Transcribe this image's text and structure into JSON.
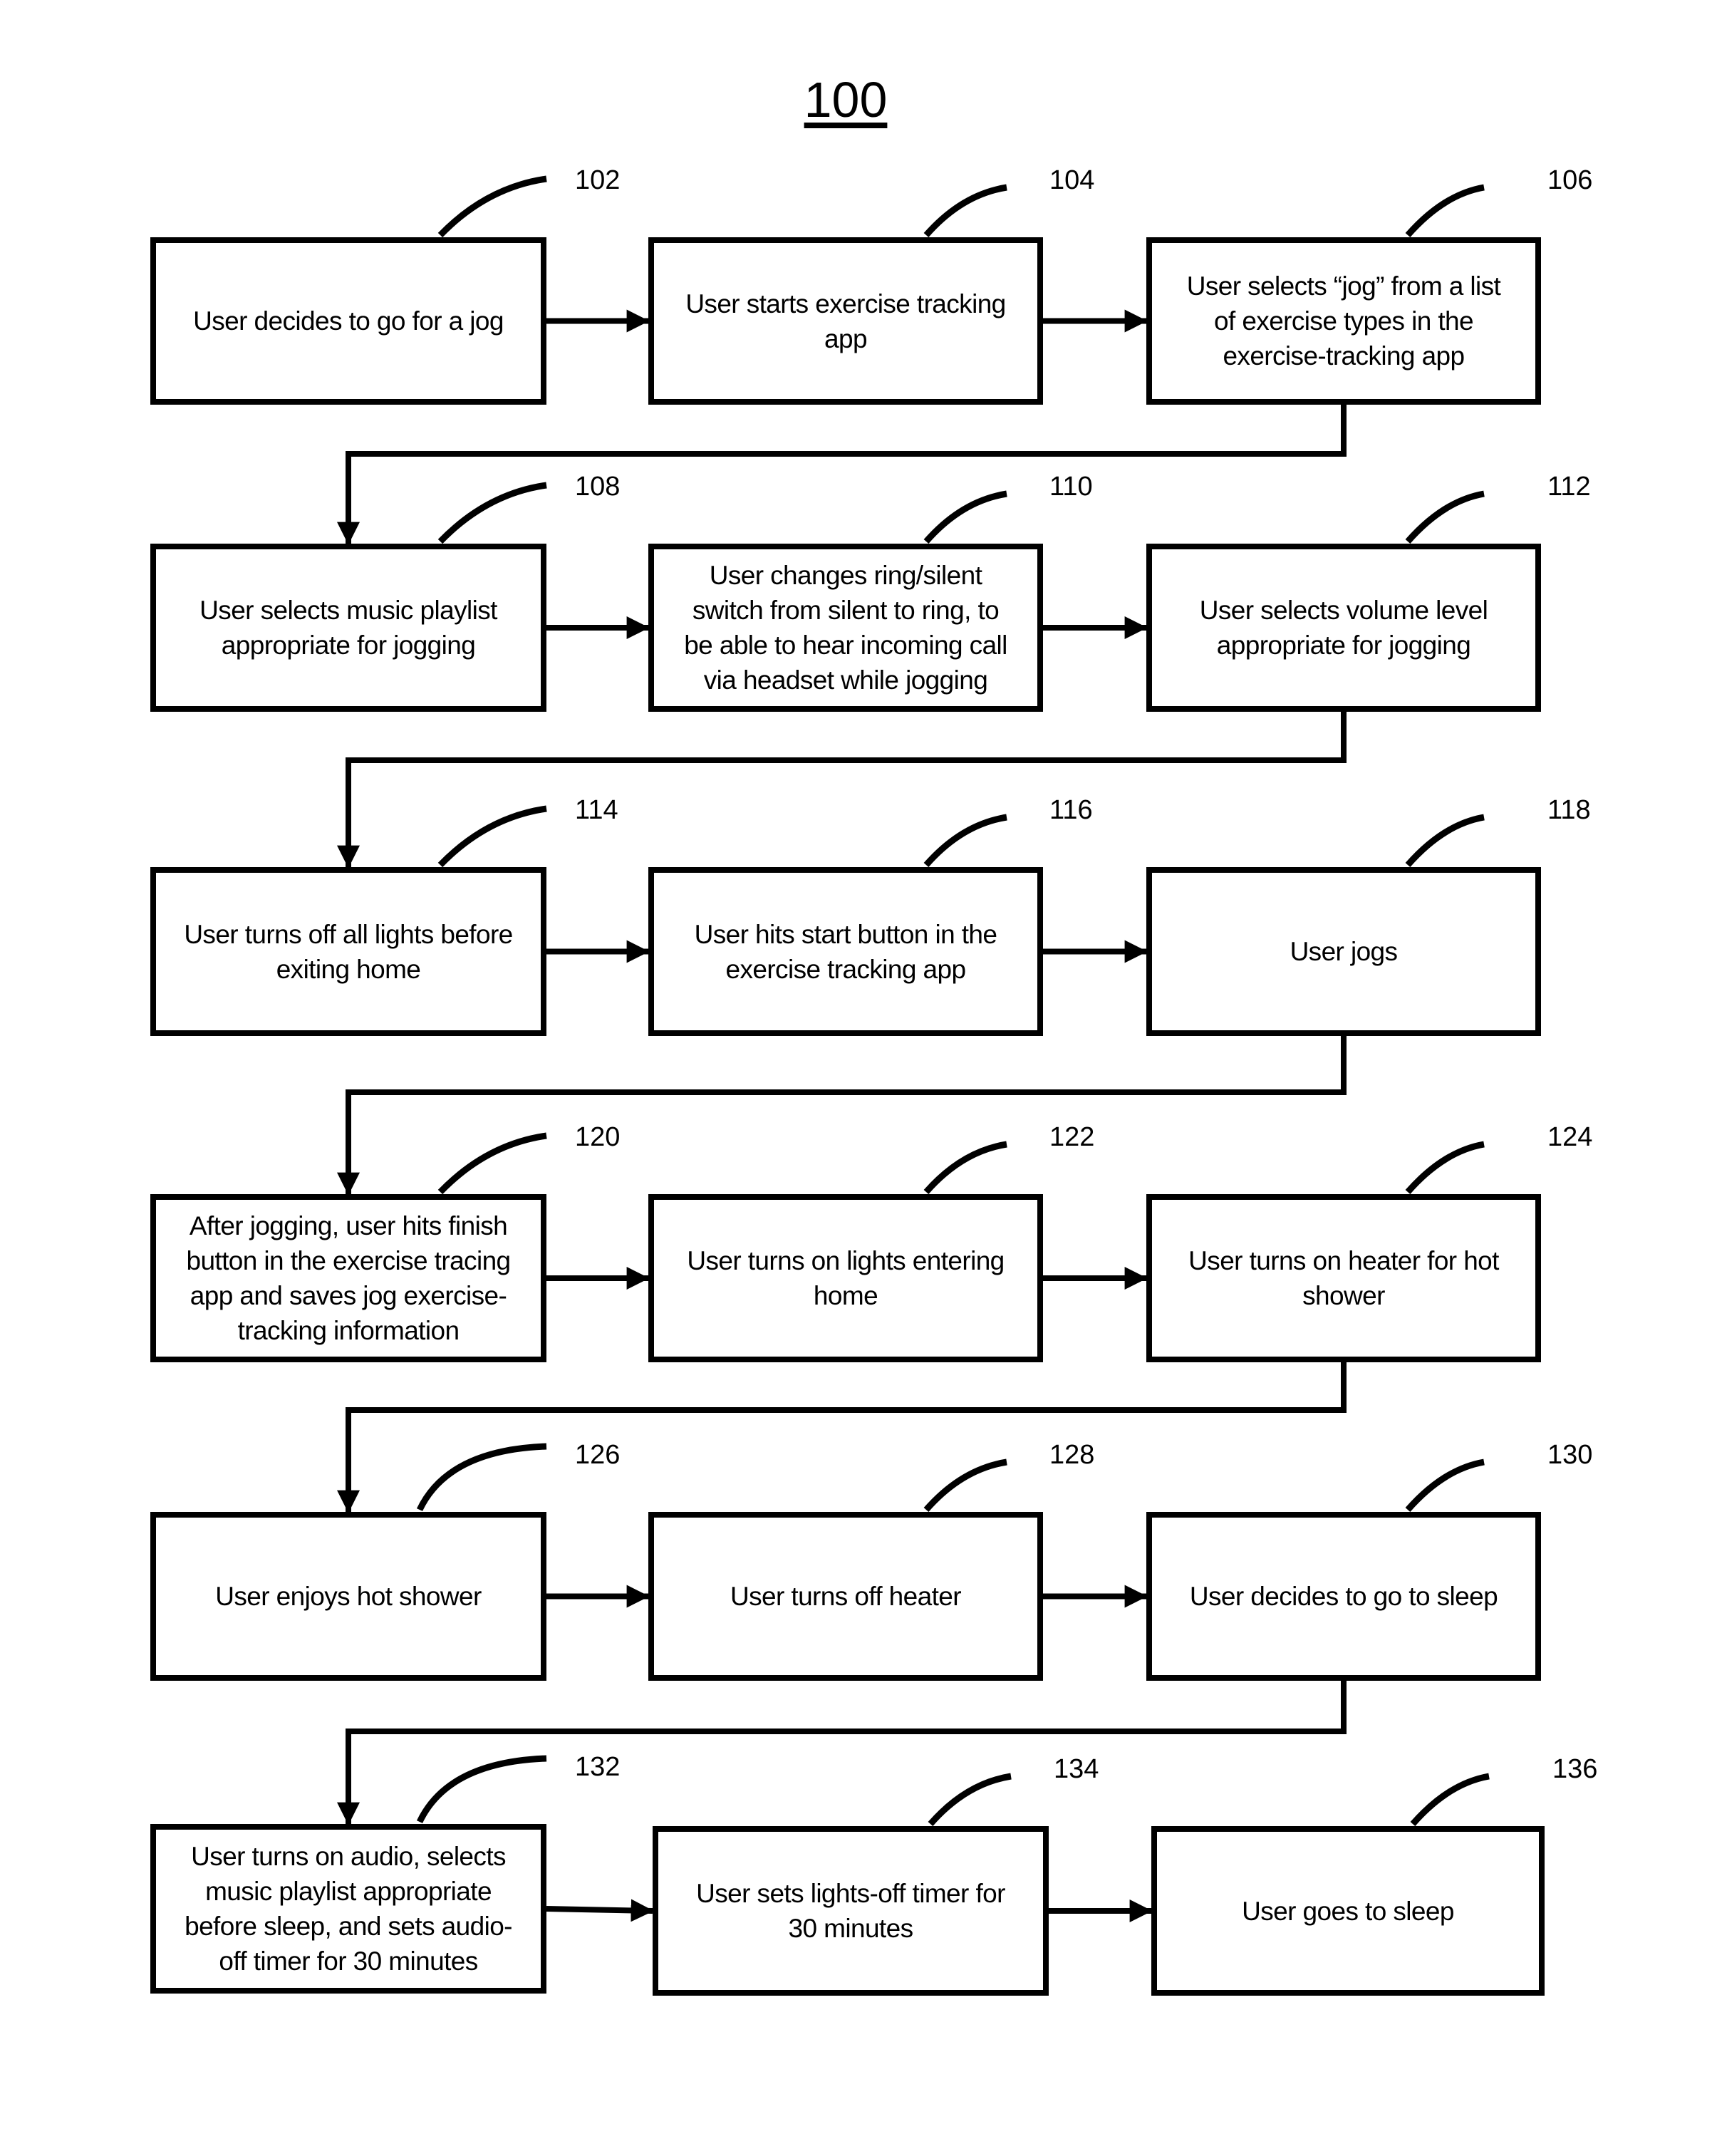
{
  "figure": {
    "title": "100"
  },
  "steps": [
    {
      "ref": "102",
      "text": "User decides to go for a jog"
    },
    {
      "ref": "104",
      "text": "User starts exercise tracking\napp"
    },
    {
      "ref": "106",
      "text": "User selects “jog” from a list\nof exercise types in the\nexercise-tracking app"
    },
    {
      "ref": "108",
      "text": "User selects music playlist\nappropriate for jogging"
    },
    {
      "ref": "110",
      "text": "User changes ring/silent\nswitch from silent to ring, to\nbe able to hear incoming call\nvia headset while jogging"
    },
    {
      "ref": "112",
      "text": "User selects volume level\nappropriate for jogging"
    },
    {
      "ref": "114",
      "text": "User turns off all lights before\nexiting home"
    },
    {
      "ref": "116",
      "text": "User hits start button in the\nexercise tracking app"
    },
    {
      "ref": "118",
      "text": "User jogs"
    },
    {
      "ref": "120",
      "text": "After jogging, user hits finish\nbutton in the exercise tracing\napp and saves jog exercise-\ntracking information"
    },
    {
      "ref": "122",
      "text": "User turns on lights entering\nhome"
    },
    {
      "ref": "124",
      "text": "User turns on heater for hot\nshower"
    },
    {
      "ref": "126",
      "text": "User enjoys hot shower"
    },
    {
      "ref": "128",
      "text": "User turns off heater"
    },
    {
      "ref": "130",
      "text": "User decides to go to sleep"
    },
    {
      "ref": "132",
      "text": "User turns on audio, selects\nmusic playlist appropriate\nbefore sleep, and sets audio-\noff timer for 30 minutes"
    },
    {
      "ref": "134",
      "text": "User sets lights-off timer for\n30 minutes"
    },
    {
      "ref": "136",
      "text": "User goes to sleep"
    }
  ],
  "flow": [
    [
      "102",
      "104"
    ],
    [
      "104",
      "106"
    ],
    [
      "106",
      "108"
    ],
    [
      "108",
      "110"
    ],
    [
      "110",
      "112"
    ],
    [
      "112",
      "114"
    ],
    [
      "114",
      "116"
    ],
    [
      "116",
      "118"
    ],
    [
      "118",
      "120"
    ],
    [
      "120",
      "122"
    ],
    [
      "122",
      "124"
    ],
    [
      "124",
      "126"
    ],
    [
      "126",
      "128"
    ],
    [
      "128",
      "130"
    ],
    [
      "130",
      "132"
    ],
    [
      "132",
      "134"
    ],
    [
      "134",
      "136"
    ]
  ]
}
